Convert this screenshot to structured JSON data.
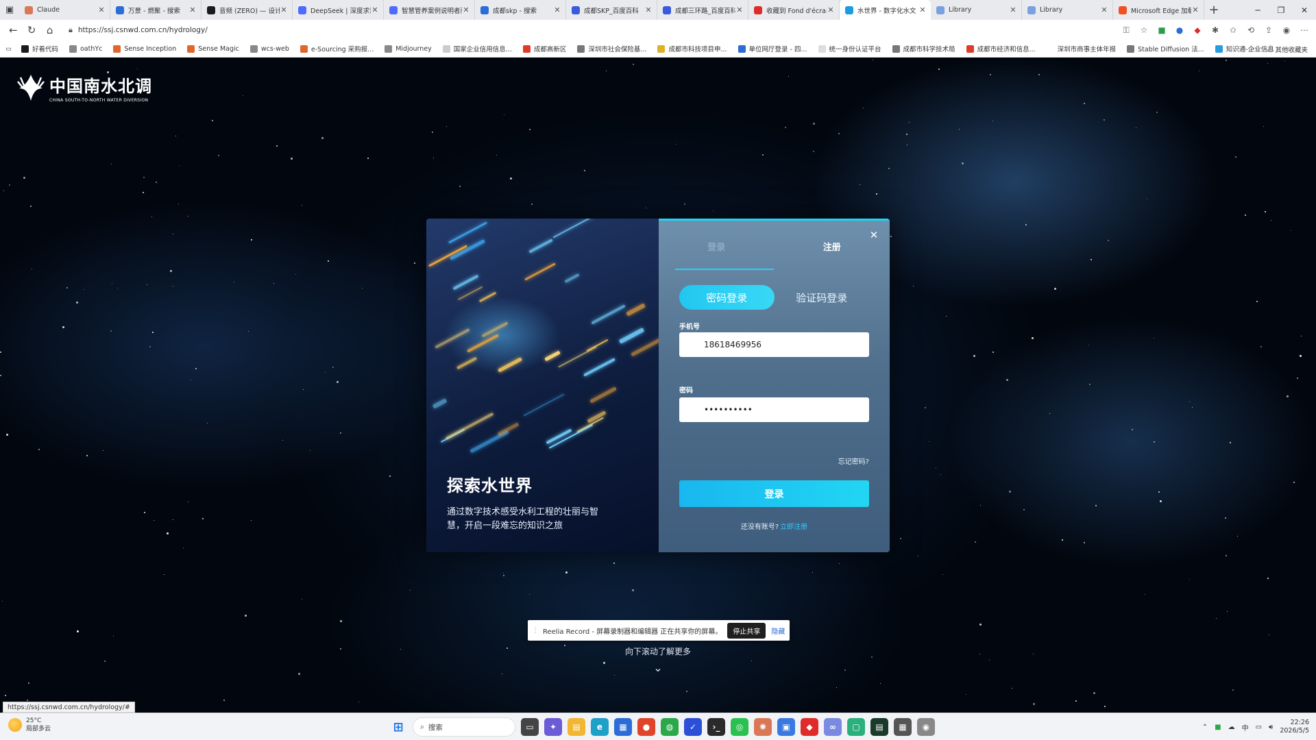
{
  "browser": {
    "tabs": [
      {
        "label": "Claude",
        "color": "#d97757",
        "active": false
      },
      {
        "label": "万景 - 燃聚 - 搜索",
        "color": "#2b6cd6",
        "active": false
      },
      {
        "label": "音频 (ZERO) — 设计师",
        "color": "#1b1b1b",
        "active": false
      },
      {
        "label": "DeepSeek | 深度求索",
        "color": "#4d6bfe",
        "active": false
      },
      {
        "label": "智慧管养案例说明者丽",
        "color": "#4d6bfe",
        "active": false
      },
      {
        "label": "成都skp - 搜索",
        "color": "#2b6cd6",
        "active": false
      },
      {
        "label": "成都SKP_百度百科",
        "color": "#3a5ae0",
        "active": false
      },
      {
        "label": "成都三环路_百度百科",
        "color": "#3a5ae0",
        "active": false
      },
      {
        "label": "收藏到 Fond d'écran",
        "color": "#e02b2b",
        "active": false
      },
      {
        "label": "水世界 - 数字化水文",
        "color": "#1c9be0",
        "active": true
      },
      {
        "label": "Library",
        "color": "#7aa0e0",
        "active": false
      },
      {
        "label": "Library",
        "color": "#7aa0e0",
        "active": false
      },
      {
        "label": "Microsoft Edge 加载项",
        "color": "#f25022",
        "active": false
      }
    ],
    "url": "https://ssj.csnwd.com.cn/hydrology/",
    "bookmarks": [
      {
        "label": "好看代码",
        "color": "#1b1b1b"
      },
      {
        "label": "oathYc",
        "color": "#888888"
      },
      {
        "label": "Sense Inception",
        "color": "#e0662b"
      },
      {
        "label": "Sense Magic",
        "color": "#e0662b"
      },
      {
        "label": "wcs-web",
        "color": "#888888"
      },
      {
        "label": "e-Sourcing 采购报...",
        "color": "#e0662b"
      },
      {
        "label": "Midjourney",
        "color": "#888888"
      },
      {
        "label": "国家企业信用信息...",
        "color": "#cccccc"
      },
      {
        "label": "成都高新区",
        "color": "#e03a2b"
      },
      {
        "label": "深圳市社会保险基...",
        "color": "#777777"
      },
      {
        "label": "成都市科技项目申...",
        "color": "#e0b02b"
      },
      {
        "label": "单位网厅登录 - 四...",
        "color": "#2b6cd6"
      },
      {
        "label": "统一身份认证平台",
        "color": "#dddddd"
      },
      {
        "label": "成都市科学技术局",
        "color": "#777777"
      },
      {
        "label": "成都市经济和信息...",
        "color": "#e03a2b"
      },
      {
        "label": "深圳市商事主体年报",
        "color": "#ffffff"
      },
      {
        "label": "Stable Diffusion 法...",
        "color": "#777777"
      },
      {
        "label": "知识通-企业信息",
        "color": "#2b9be0"
      }
    ],
    "other_bookmarks": "其他收藏夹",
    "status_url": "https://ssj.csnwd.com.cn/hydrology/#"
  },
  "page": {
    "logo_cn": "中国南水北调",
    "logo_en": "CHINA SOUTH-TO-NORTH WATER DIVERSION",
    "scroll_hint": "向下滚动了解更多"
  },
  "modal": {
    "left_title": "探索水世界",
    "left_desc": "通过数字技术感受水利工程的壮丽与智慧，开启一段难忘的知识之旅",
    "tab_login": "登录",
    "tab_register": "注册",
    "mode_password": "密码登录",
    "mode_code": "验证码登录",
    "phone_label": "手机号",
    "phone_value": "18618469956",
    "password_label": "密码",
    "password_value": "••••••••••",
    "forgot": "忘记密码?",
    "login_button": "登录",
    "no_account": "还没有账号?",
    "register_now": "立即注册"
  },
  "share_bar": {
    "text": "Reelia Record - 屏幕录制器和编辑器 正在共享你的屏幕。",
    "stop": "停止共享",
    "hide": "隐藏"
  },
  "taskbar": {
    "temperature": "25°C",
    "weather": "局部多云",
    "search_placeholder": "搜索",
    "ime": "中",
    "time": "22:26",
    "date": "2026/5/5"
  },
  "colors": {
    "accent": "#22d3f0",
    "modal_right_bg": "#5a7a98"
  }
}
